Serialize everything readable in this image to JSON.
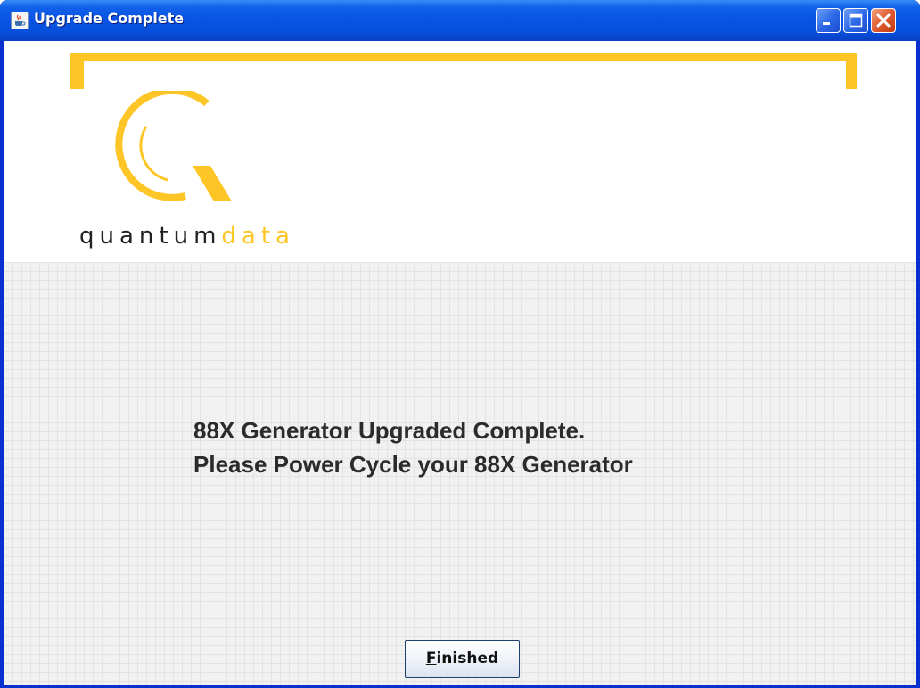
{
  "window": {
    "title": "Upgrade Complete",
    "icon": "java-coffee-cup-icon",
    "controls": [
      "minimize-icon",
      "maximize-icon",
      "close-icon"
    ]
  },
  "logo": {
    "mark": "quantum-q-logo-icon",
    "text_part1": "quantum",
    "text_part2": "data"
  },
  "message": {
    "line1": "88X Generator Upgraded Complete.",
    "line2": "Please Power Cycle your 88X Generator"
  },
  "button": {
    "finished_mnemonic": "F",
    "finished_rest": "inished"
  },
  "colors": {
    "brand_yellow": "#fdc525",
    "titlebar_blue": "#0a53e3",
    "close_red": "#de5a30"
  }
}
